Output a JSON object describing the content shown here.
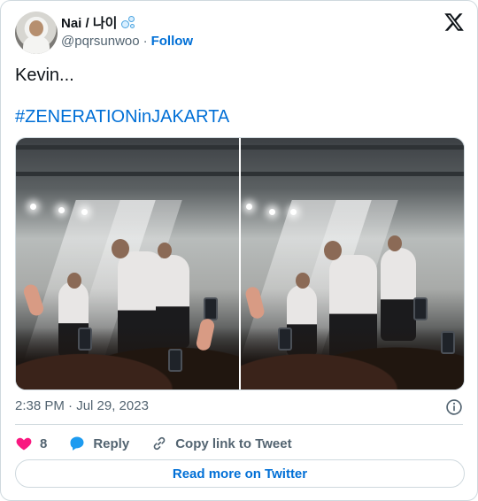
{
  "author": {
    "display_name": "Nai / 나이",
    "handle": "@pqrsunwoo",
    "separator": "·",
    "follow_label": "Follow",
    "emoji_icon": "bubbles-icon",
    "logo_icon": "x-logo-icon"
  },
  "tweet": {
    "text": "Kevin...",
    "hashtag": "#ZENERATIONinJAKARTA"
  },
  "media": {
    "photos": [
      {
        "name": "concert-photo-1"
      },
      {
        "name": "concert-photo-2"
      }
    ]
  },
  "timestamp": "2:38 PM · Jul 29, 2023",
  "actions": {
    "like_count": "8",
    "reply_label": "Reply",
    "copy_label": "Copy link to Tweet"
  },
  "read_more_label": "Read more on Twitter",
  "colors": {
    "link": "#006fd6",
    "muted": "#536471",
    "like": "#f91880",
    "reply": "#1d9bf0",
    "border": "#cfd9de"
  }
}
